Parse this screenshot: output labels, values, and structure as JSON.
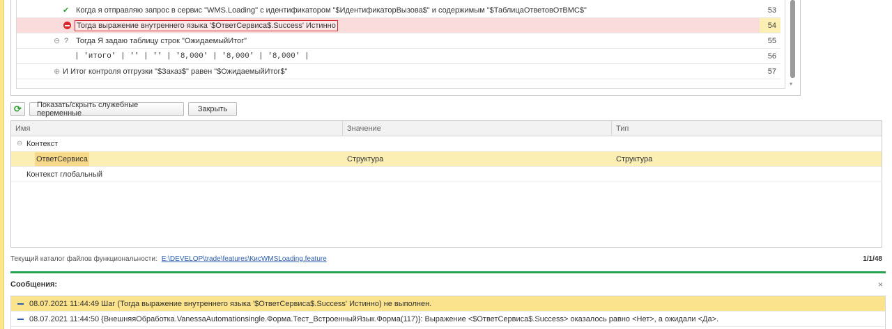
{
  "steps": [
    {
      "status": "passed",
      "text": "Когда я отправляю запрос в сервис \"WMS.Loading\" с идентификатором \"$ИдентификаторВызова$\" и содержимым \"$ТаблицаОтветовОтВМС$\"",
      "line": "53"
    },
    {
      "status": "failed",
      "text": "Тогда выражение внутреннего языка '$ОтветСервиса$.Success' Истинно",
      "line": "54"
    },
    {
      "status": "pending",
      "text": "Тогда Я задаю таблицу строк \"ОжидаемыйИтог\"",
      "line": "55"
    },
    {
      "status": "table",
      "text": "| 'итого' | '' | '' | '8,000' | '8,000' | '8,000' |",
      "line": "56"
    },
    {
      "status": "collapsed",
      "text": "И Итог контроля отгрузки \"$Заказ$\" равен \"$ОжидаемыйИтог$\"",
      "line": "57"
    }
  ],
  "icons": {
    "passed": "check-icon",
    "failed": "stop-icon",
    "pending": "question-icon",
    "collapse": "collapse-icon",
    "expand": "expand-icon",
    "refresh": "refresh-icon",
    "message": "dash-icon",
    "close": "close-icon"
  },
  "glyphs": {
    "check": "✔",
    "question": "?",
    "collapse": "⊖",
    "expand": "⊕",
    "refresh": "⟳",
    "close": "×",
    "scroll_down": "▾"
  },
  "toolbar": {
    "show_hide_label": "Показать/скрыть служебные переменные",
    "close_label": "Закрыть"
  },
  "variables": {
    "columns": [
      "Имя",
      "Значение",
      "Тип"
    ],
    "rows": [
      {
        "name": "Контекст",
        "value": "",
        "type": "",
        "level": 0,
        "expanded": true
      },
      {
        "name": "ОтветСервиса",
        "value": "Структура",
        "type": "Структура",
        "level": 1,
        "selected": true
      },
      {
        "name": "Контекст глобальный",
        "value": "",
        "type": "",
        "level": 0
      }
    ]
  },
  "catalog": {
    "label": "Текущий каталог файлов функциональности:",
    "path": "E:\\DEVELOP\\trade\\features\\КисWMSLoading.feature",
    "counter": "1/1/48"
  },
  "messages": {
    "title": "Сообщения:",
    "items": [
      "08.07.2021 11:44:49 Шаг (Тогда выражение внутреннего языка '$ОтветСервиса$.Success' Истинно) не выполнен.",
      "08.07.2021 11:44:50 {ВнешняяОбработка.VanessaAutomationsingle.Форма.Тест_ВстроенныйЯзык.Форма(117)}: Выражение <$ОтветСервиса$.Success> оказалось равно <Нет>, а ожидали <Да>."
    ]
  },
  "colors": {
    "accent_green": "#27a356",
    "error_red": "#d9262c",
    "selection_yellow": "#fcefb4",
    "link_blue": "#2a5db0"
  }
}
